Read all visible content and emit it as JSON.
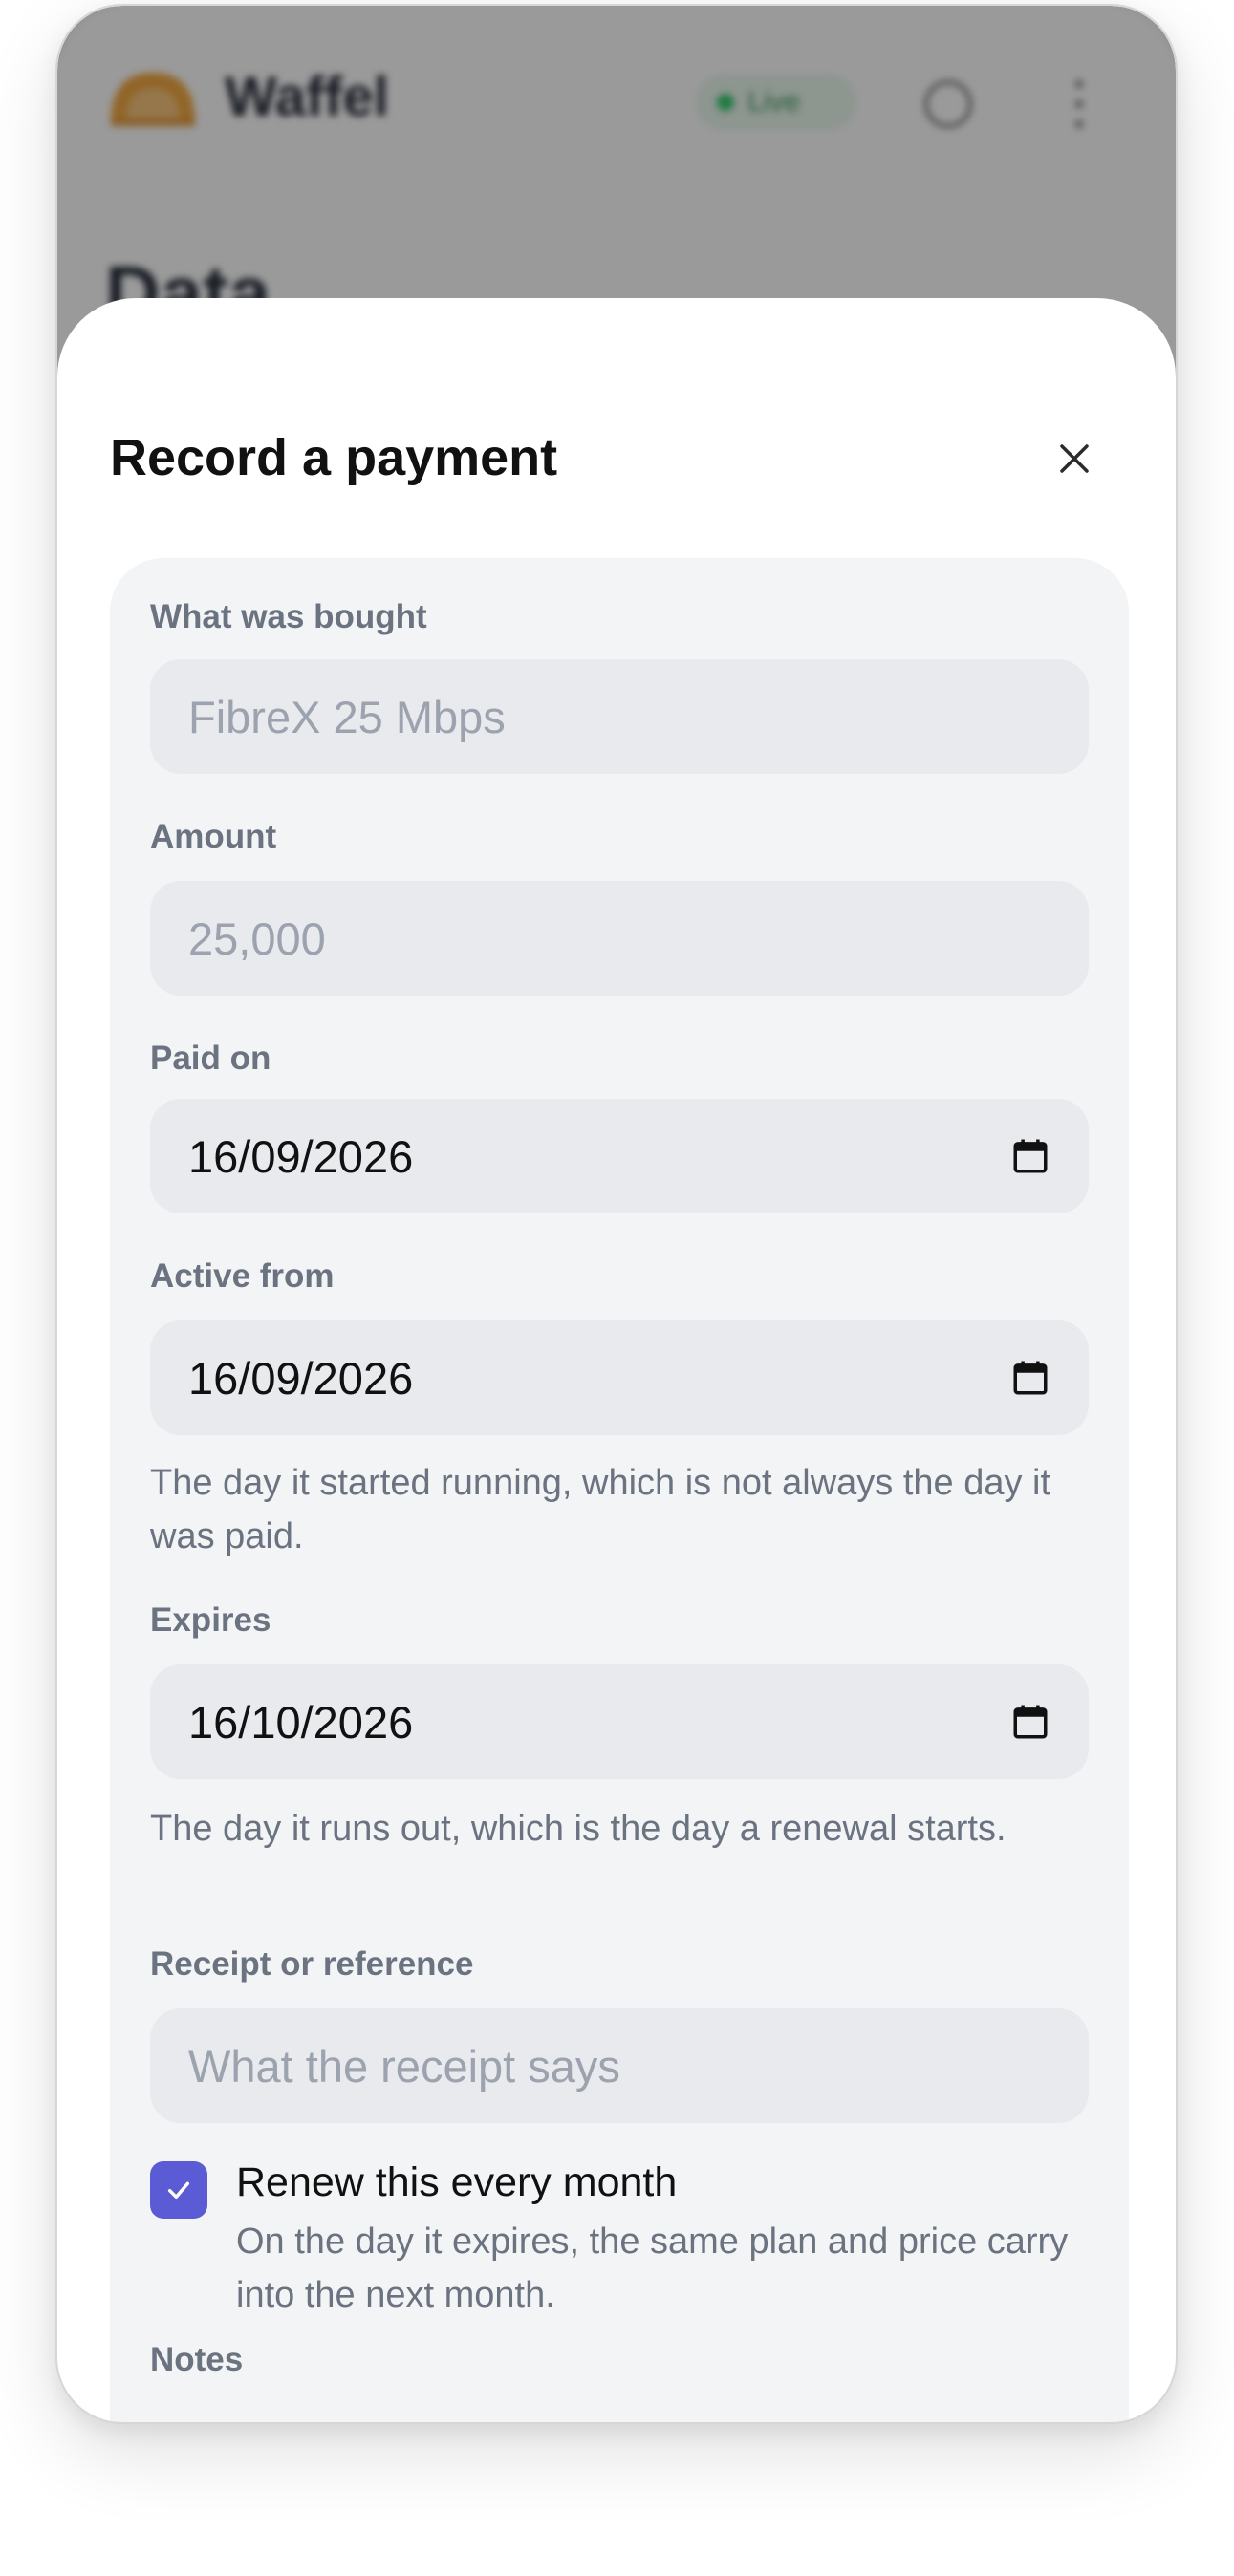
{
  "background": {
    "app_name": "Waffel",
    "status_badge": "Live",
    "page_title": "Data"
  },
  "sheet": {
    "title": "Record a payment",
    "fields": {
      "what_bought": {
        "label": "What was bought",
        "placeholder": "FibreX 25 Mbps"
      },
      "amount": {
        "label": "Amount",
        "placeholder": "25,000"
      },
      "paid_on": {
        "label": "Paid on",
        "value": "16/09/2026"
      },
      "active_from": {
        "label": "Active from",
        "value": "16/09/2026",
        "hint": "The day it started running, which is not always the day it was paid."
      },
      "expires": {
        "label": "Expires",
        "value": "16/10/2026",
        "hint": "The day it runs out, which is the day a renewal starts."
      },
      "receipt": {
        "label": "Receipt or reference",
        "placeholder": "What the receipt says"
      }
    },
    "renew": {
      "checked": true,
      "label": "Renew this every month",
      "hint": "On the day it expires, the same plan and price carry into the next month."
    },
    "next_label": "Notes"
  },
  "colors": {
    "accent": "#5b5bd6",
    "live_green": "#22c55e",
    "logo_orange": "#f59e0b"
  }
}
